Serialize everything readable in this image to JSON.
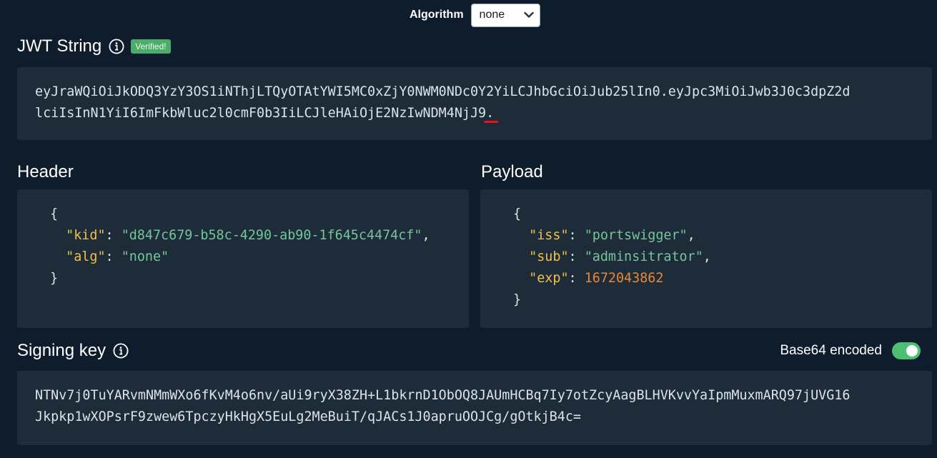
{
  "algorithm": {
    "label": "Algorithm",
    "selected": "none"
  },
  "jwt": {
    "title": "JWT String",
    "badge": "Verified!",
    "line1": "eyJraWQiOiJkODQ3YzY3OS1iNThjLTQyOTAtYWI5MC0xZjY0NWM0NDc0Y2YiLCJhbGciOiJub25lIn0.eyJpc3MiOiJwb3J0c3dpZ2d",
    "line2": "lciIsInN1YiI6ImFkbWluc2l0cmF0b3IiLCJleHAiOjE2NzIwNDM4NjJ9",
    "trailing_dot": "."
  },
  "header": {
    "title": "Header",
    "open": "{",
    "close": "}",
    "kid_key": "\"kid\"",
    "kid_value": "\"d847c679-b58c-4290-ab90-1f645c4474cf\"",
    "alg_key": "\"alg\"",
    "alg_value": "\"none\""
  },
  "payload": {
    "title": "Payload",
    "open": "{",
    "close": "}",
    "iss_key": "\"iss\"",
    "iss_value": "\"portswigger\"",
    "sub_key": "\"sub\"",
    "sub_value": "\"adminsitrator\"",
    "exp_key": "\"exp\"",
    "exp_value": "1672043862"
  },
  "signing": {
    "title": "Signing key",
    "base64_label": "Base64 encoded",
    "base64_enabled": true,
    "line1": "NTNv7j0TuYARvmNMmWXo6fKvM4o6nv/aUi9ryX38ZH+L1bkrnD1ObOQ8JAUmHCBq7Iy7otZcyAagBLHVKvvYaIpmMuxmARQ97jUVG16",
    "line2": "Jkpkp1wXOPsrF9zwew6TpczyHkHgX5EuLg2MeBuiT/qJACs1J0apruOOJCg/gOtkjB4c="
  },
  "colors": {
    "background": "#0e1c2b",
    "panel": "#1e2b38",
    "key": "#f0c14b",
    "string": "#74c79b",
    "number": "#e8883a",
    "badge": "#4cad6b",
    "toggle": "#4cbf74",
    "error_underline": "#e01818"
  },
  "icons": {
    "info": "info-circle-icon",
    "dropdown": "chevron-down-icon"
  }
}
